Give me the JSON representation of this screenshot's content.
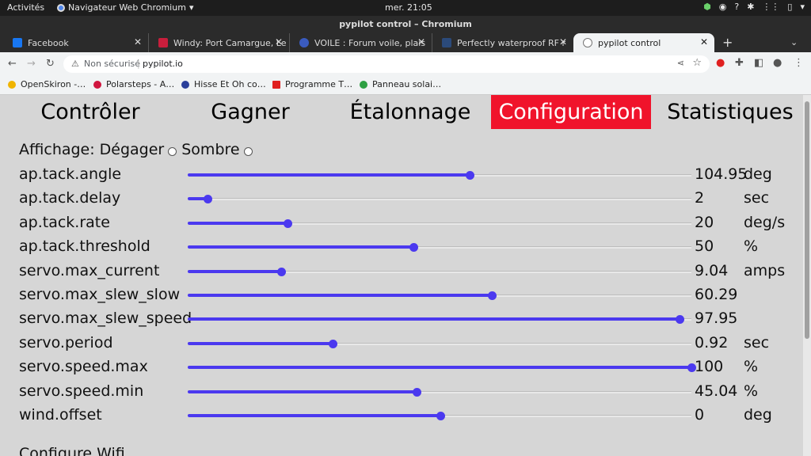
{
  "os": {
    "activities": "Activités",
    "app_menu": "Navigateur Web Chromium",
    "clock": "mer. 21:05",
    "tray": [
      "?",
      "✱",
      "⋮⋮",
      "▯",
      "▾"
    ]
  },
  "window": {
    "title": "pypilot control – Chromium"
  },
  "tabs": [
    {
      "label": "Facebook",
      "color": "#1877f2"
    },
    {
      "label": "Windy: Port Camargue, Le",
      "color": "#c81e3c"
    },
    {
      "label": "VOILE : Forum voile, plais",
      "color": "#3a5bbf"
    },
    {
      "label": "Perfectly waterproof RF r",
      "color": "#2b4a7a"
    },
    {
      "label": "pypilot control",
      "color": "#777777"
    }
  ],
  "toolbar": {
    "not_secure": "Non sécurisé",
    "url": "pypilot.io"
  },
  "bookmarks": [
    {
      "label": "OpenSkiron -…",
      "color": "#f0b400"
    },
    {
      "label": "Polarsteps - A…",
      "color": "#d0163f"
    },
    {
      "label": "Hisse Et Oh co…",
      "color": "#2a3f9a"
    },
    {
      "label": "Programme T…",
      "color": "#e02020"
    },
    {
      "label": "Panneau solai…",
      "color": "#2ea043"
    }
  ],
  "nav": [
    "Contrôler",
    "Gagner",
    "Étalonnage",
    "Configuration",
    "Statistiques"
  ],
  "nav_active": "Configuration",
  "display": {
    "label": "Affichage:",
    "option1": "Dégager",
    "option2": "Sombre"
  },
  "settings": [
    {
      "name": "ap.tack.angle",
      "value": "104.95",
      "unit": "deg",
      "fraction": 0.56
    },
    {
      "name": "ap.tack.delay",
      "value": "2",
      "unit": "sec",
      "fraction": 0.04
    },
    {
      "name": "ap.tack.rate",
      "value": "20",
      "unit": "deg/s",
      "fraction": 0.198
    },
    {
      "name": "ap.tack.threshold",
      "value": "50",
      "unit": "%",
      "fraction": 0.448
    },
    {
      "name": "servo.max_current",
      "value": "9.04",
      "unit": "amps",
      "fraction": 0.185
    },
    {
      "name": "servo.max_slew_slow",
      "value": "60.29",
      "unit": "",
      "fraction": 0.604
    },
    {
      "name": "servo.max_slew_speed",
      "value": "97.95",
      "unit": "",
      "fraction": 0.977
    },
    {
      "name": "servo.period",
      "value": "0.92",
      "unit": "sec",
      "fraction": 0.288
    },
    {
      "name": "servo.speed.max",
      "value": "100",
      "unit": "%",
      "fraction": 1.0
    },
    {
      "name": "servo.speed.min",
      "value": "45.04",
      "unit": "%",
      "fraction": 0.455
    },
    {
      "name": "wind.offset",
      "value": "0",
      "unit": "deg",
      "fraction": 0.502
    }
  ],
  "wifi_heading": "Configure Wifi",
  "colors": {
    "accent": "#4b39ef",
    "active_tab": "#f0132b"
  }
}
